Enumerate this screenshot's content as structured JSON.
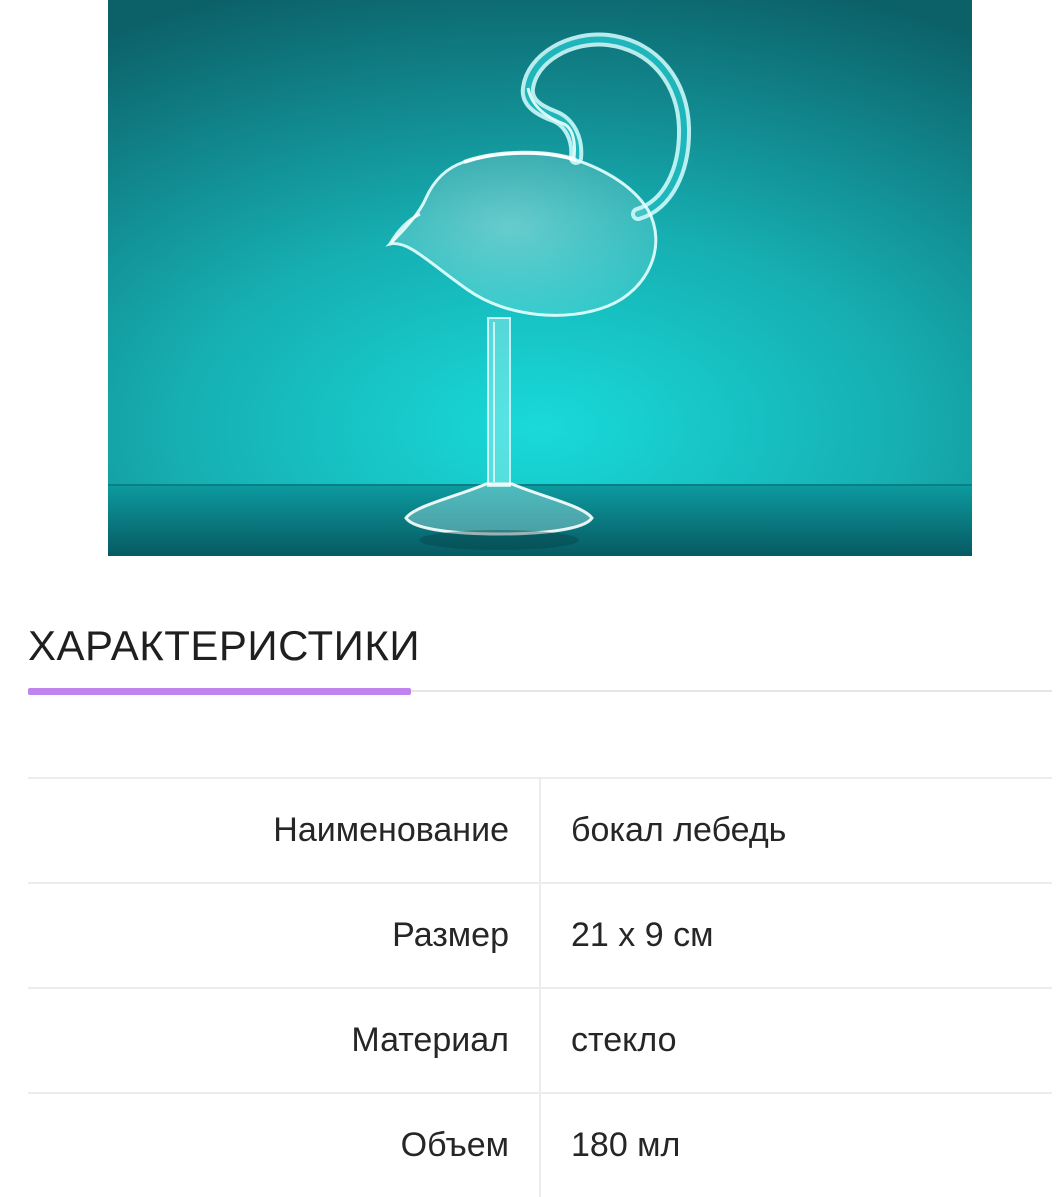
{
  "product_image": {
    "subject": "swan-shaped-wine-glass",
    "background_color": "#19b9bd"
  },
  "section": {
    "title": "ХАРАКТЕРИСТИКИ",
    "accent_color": "#c084ee"
  },
  "specs": [
    {
      "label": "Наименование",
      "value": "бокал лебедь"
    },
    {
      "label": "Размер",
      "value": "21 х 9 см"
    },
    {
      "label": "Материал",
      "value": "стекло"
    },
    {
      "label": "Объем",
      "value": "180 мл"
    }
  ]
}
